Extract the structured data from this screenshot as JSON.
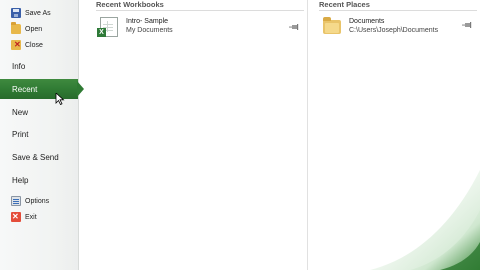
{
  "menu": {
    "commands_top": [
      {
        "label": "Save As",
        "icon": "save-icon"
      },
      {
        "label": "Open",
        "icon": "open-folder-icon"
      },
      {
        "label": "Close",
        "icon": "close-file-icon"
      }
    ],
    "tabs": [
      {
        "label": "Info",
        "active": false
      },
      {
        "label": "Recent",
        "active": true
      },
      {
        "label": "New",
        "active": false
      },
      {
        "label": "Print",
        "active": false
      },
      {
        "label": "Save & Send",
        "active": false
      },
      {
        "label": "Help",
        "active": false
      }
    ],
    "commands_bottom": [
      {
        "label": "Options",
        "icon": "options-icon"
      },
      {
        "label": "Exit",
        "icon": "exit-icon"
      }
    ]
  },
  "recent_workbooks": {
    "heading": "Recent Workbooks",
    "items": [
      {
        "name": "Intro- Sample",
        "location": "My Documents",
        "icon": "excel-file-icon"
      }
    ]
  },
  "recent_places": {
    "heading": "Recent Places",
    "items": [
      {
        "name": "Documents",
        "path": "C:\\Users\\Joseph\\Documents",
        "icon": "folder-icon"
      }
    ]
  },
  "colors": {
    "active_tab": "#2f7a33",
    "menu_background": "#f1f3f2",
    "accent_green": "#3c8a3c"
  }
}
